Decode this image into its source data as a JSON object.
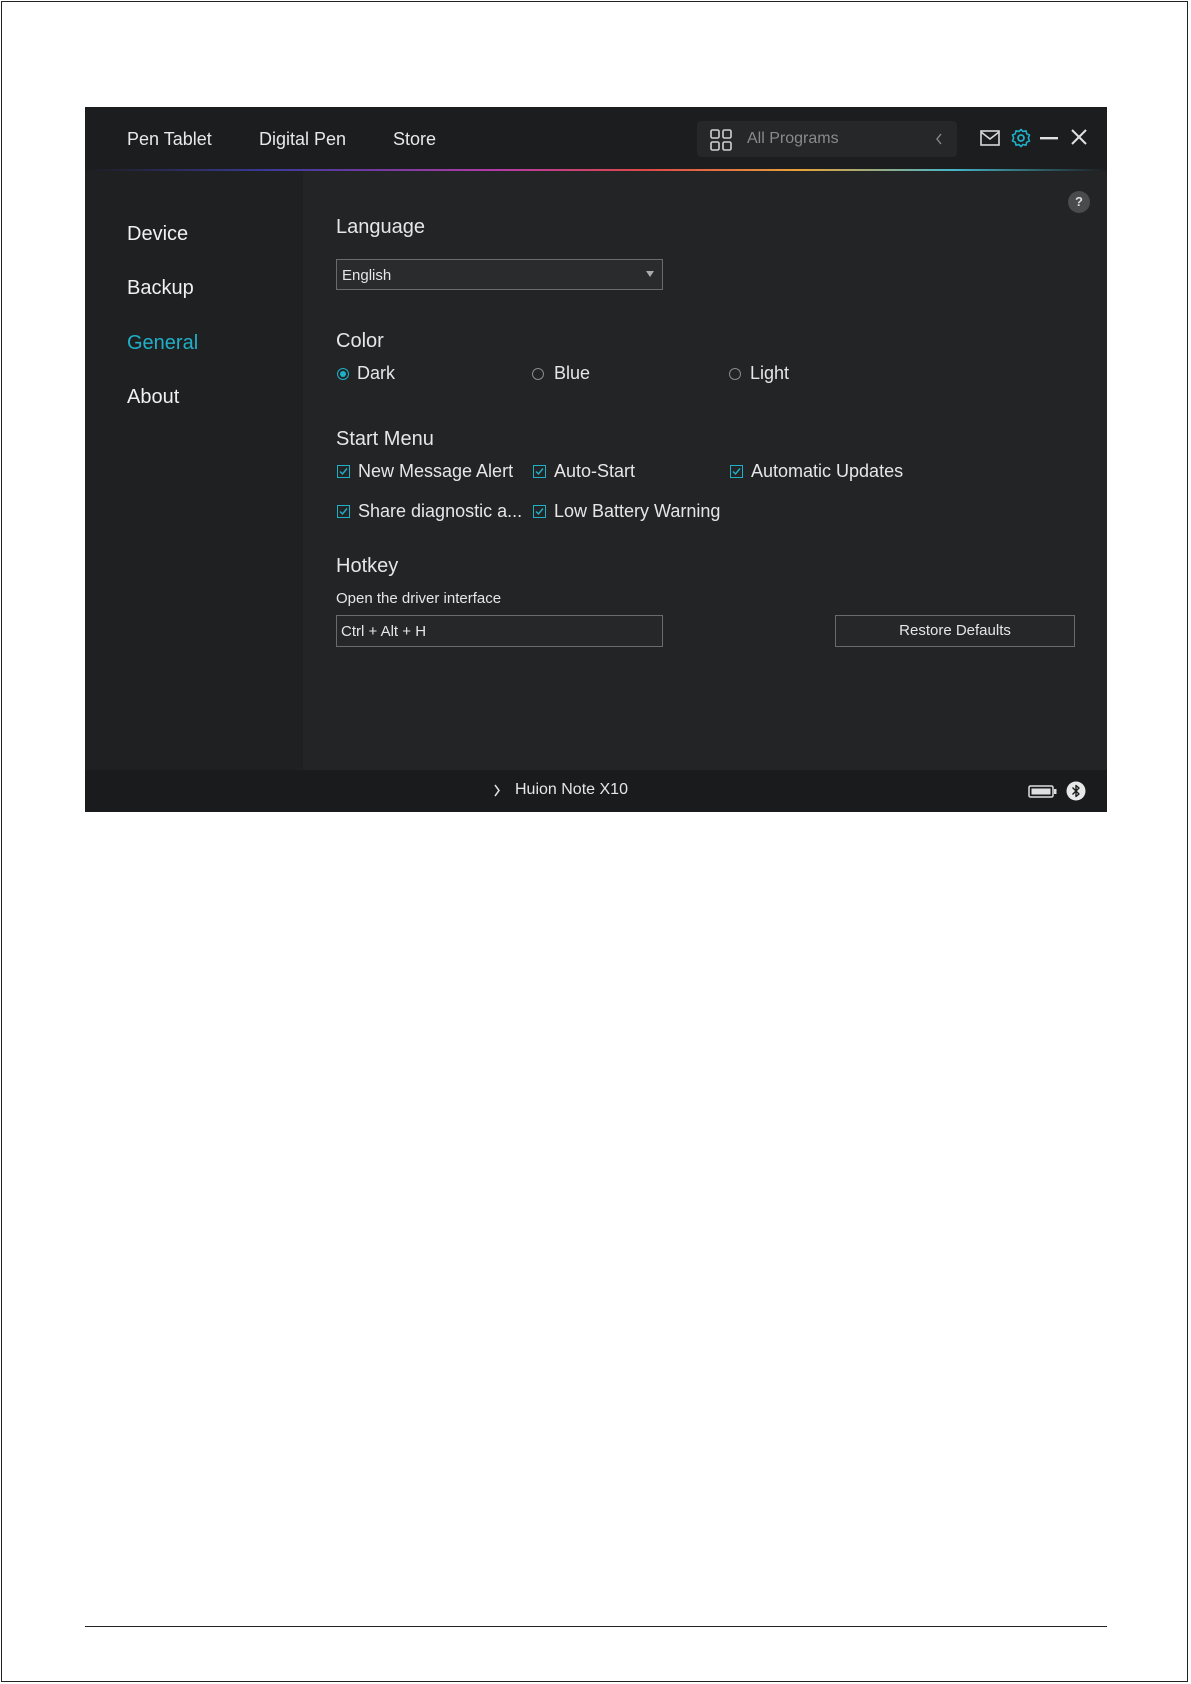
{
  "header": {
    "tabs": [
      {
        "label": "Pen Tablet"
      },
      {
        "label": "Digital Pen"
      },
      {
        "label": "Store"
      }
    ],
    "programs_label": "All Programs"
  },
  "sidebar": {
    "items": [
      {
        "label": "Device"
      },
      {
        "label": "Backup"
      },
      {
        "label": "General"
      },
      {
        "label": "About"
      }
    ]
  },
  "general": {
    "help_label": "?",
    "language": {
      "title": "Language",
      "selected": "English"
    },
    "color": {
      "title": "Color",
      "options": [
        {
          "label": "Dark",
          "selected": true
        },
        {
          "label": "Blue",
          "selected": false
        },
        {
          "label": "Light",
          "selected": false
        }
      ]
    },
    "start_menu": {
      "title": "Start Menu",
      "options": [
        {
          "label": "New Message Alert",
          "checked": true
        },
        {
          "label": "Auto-Start",
          "checked": true
        },
        {
          "label": "Automatic Updates",
          "checked": true
        },
        {
          "label": "Share diagnostic a...",
          "checked": true
        },
        {
          "label": "Low Battery Warning",
          "checked": true
        }
      ]
    },
    "hotkey": {
      "title": "Hotkey",
      "label": "Open the driver interface",
      "value": "Ctrl + Alt + H",
      "restore_label": "Restore Defaults"
    }
  },
  "status_bar": {
    "device_name": "Huion Note X10"
  },
  "colors": {
    "accent": "#1fb0c8",
    "background": "#232425"
  }
}
